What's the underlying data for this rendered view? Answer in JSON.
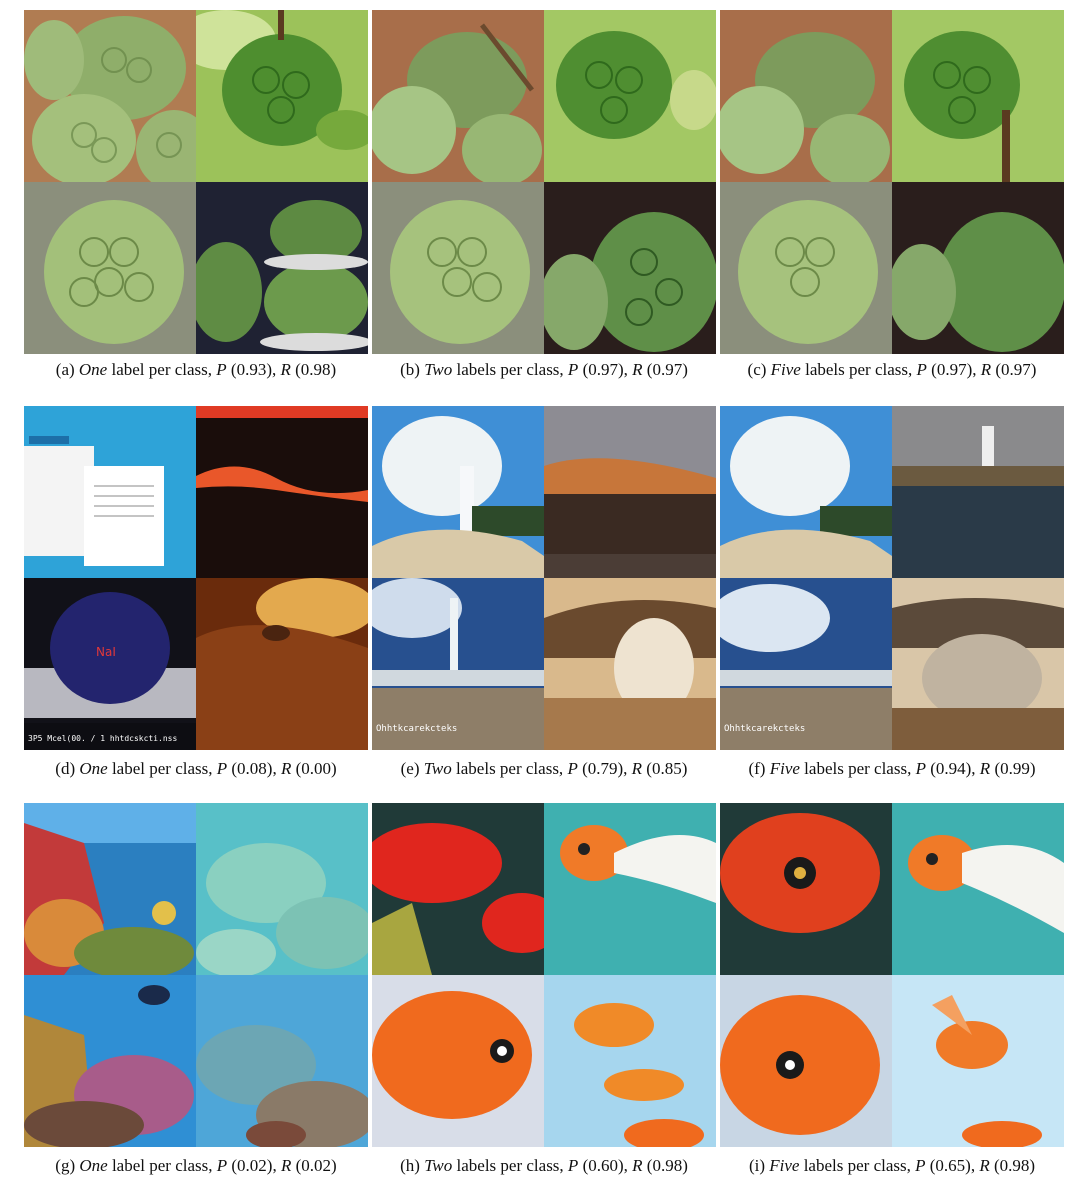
{
  "figure": {
    "captions": [
      {
        "id": "a",
        "prefix": "(a)",
        "count": "One",
        "suffix": "label per class,",
        "p_label": "P",
        "p": "(0.93),",
        "r_label": "R",
        "r": "(0.98)"
      },
      {
        "id": "b",
        "prefix": "(b)",
        "count": "Two",
        "suffix": "labels per class,",
        "p_label": "P",
        "p": "(0.97),",
        "r_label": "R",
        "r": "(0.97)"
      },
      {
        "id": "c",
        "prefix": "(c)",
        "count": "Five",
        "suffix": "labels per class,",
        "p_label": "P",
        "p": "(0.97),",
        "r_label": "R",
        "r": "(0.97)"
      },
      {
        "id": "d",
        "prefix": "(d)",
        "count": "One",
        "suffix": "label per class,",
        "p_label": "P",
        "p": "(0.08),",
        "r_label": "R",
        "r": "(0.00)"
      },
      {
        "id": "e",
        "prefix": "(e)",
        "count": "Two",
        "suffix": "labels per class,",
        "p_label": "P",
        "p": "(0.79),",
        "r_label": "R",
        "r": "(0.85)"
      },
      {
        "id": "f",
        "prefix": "(f)",
        "count": "Five",
        "suffix": "labels per class,",
        "p_label": "P",
        "p": "(0.94),",
        "r_label": "R",
        "r": "(0.99)"
      },
      {
        "id": "g",
        "prefix": "(g)",
        "count": "One",
        "suffix": "label per class,",
        "p_label": "P",
        "p": "(0.02),",
        "r_label": "R",
        "r": "(0.02)"
      },
      {
        "id": "h",
        "prefix": "(h)",
        "count": "Two",
        "suffix": "labels per class,",
        "p_label": "P",
        "p": "(0.60),",
        "r_label": "R",
        "r": "(0.98)"
      },
      {
        "id": "i",
        "prefix": "(i)",
        "count": "Five",
        "suffix": "labels per class,",
        "p_label": "P",
        "p": "(0.65),",
        "r_label": "R",
        "r": "(0.98)"
      }
    ],
    "panel_d_text": {
      "bottom_text": "3P5 Mcel(00. / 1 hhtdcskcti.nss",
      "tile_label": "NaI"
    },
    "panel_e_text": "Ohhtkcarekcteks",
    "panel_f_text": "Ohhtkcarekcteks",
    "colors": {
      "apple_green": "#8fae6a",
      "leaf_green": "#6e9c3a",
      "sky_blue": "#3f8fd6",
      "geyser_white": "#eef3f5",
      "reef_teal": "#58c0c8",
      "goldfish_orange": "#f06a1e"
    }
  }
}
